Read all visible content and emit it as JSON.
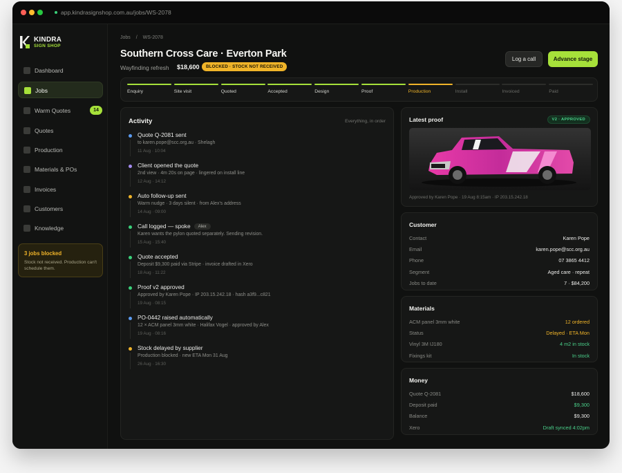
{
  "browser": {
    "url": "app.kindrasignshop.com.au/jobs/WS-2078"
  },
  "brand": {
    "name": "KINDRA",
    "sub": "SIGN SHOP",
    "accent": "#a6e13a"
  },
  "sidebar": {
    "items": [
      {
        "label": "Dashboard",
        "icon": "dashboard-icon",
        "active": false,
        "badge": ""
      },
      {
        "label": "Jobs",
        "icon": "jobs-icon",
        "active": true,
        "badge": ""
      },
      {
        "label": "Warm Quotes",
        "icon": "warm-quotes-icon",
        "active": false,
        "badge": "14"
      },
      {
        "label": "Quotes",
        "icon": "quotes-icon",
        "active": false,
        "badge": ""
      },
      {
        "label": "Production",
        "icon": "production-icon",
        "active": false,
        "badge": ""
      },
      {
        "label": "Materials & POs",
        "icon": "materials-icon",
        "active": false,
        "badge": ""
      },
      {
        "label": "Invoices",
        "icon": "invoices-icon",
        "active": false,
        "badge": ""
      },
      {
        "label": "Customers",
        "icon": "customers-icon",
        "active": false,
        "badge": ""
      },
      {
        "label": "Knowledge",
        "icon": "knowledge-icon",
        "active": false,
        "badge": ""
      }
    ],
    "alert": {
      "title": "3 jobs blocked",
      "body": "Stock not received. Production can't schedule them.",
      "color": "#f0b429"
    }
  },
  "header": {
    "breadcrumb": [
      "Jobs",
      "/",
      "WS-2078"
    ],
    "title": "Southern Cross Care · Everton Park",
    "subtitle": "Wayfinding refresh",
    "amount": "$18,600",
    "status": "BLOCKED · STOCK NOT RECEIVED",
    "status_color": "#f0b429",
    "actions": {
      "call": "Log a call",
      "advance": "Advance stage"
    }
  },
  "stages": [
    {
      "label": "Enquiry",
      "state": "done"
    },
    {
      "label": "Site visit",
      "state": "done"
    },
    {
      "label": "Quoted",
      "state": "done"
    },
    {
      "label": "Accepted",
      "state": "done"
    },
    {
      "label": "Design",
      "state": "done"
    },
    {
      "label": "Proof",
      "state": "done"
    },
    {
      "label": "Production",
      "state": "current"
    },
    {
      "label": "Install",
      "state": "todo"
    },
    {
      "label": "Invoiced",
      "state": "todo"
    },
    {
      "label": "Paid",
      "state": "todo"
    }
  ],
  "activity": {
    "title": "Activity",
    "filter": "Everything, in order",
    "events": [
      {
        "title": "Quote Q-2081 sent",
        "tag": "",
        "detail": "to karen.pope@scc.org.au · Shelagh",
        "time": "11 Aug · 10:04",
        "color": "#5b9bf0"
      },
      {
        "title": "Client opened the quote",
        "tag": "",
        "detail": "2nd view · 4m 20s on page · lingered on install line",
        "time": "12 Aug · 14:12",
        "color": "#a48cf0"
      },
      {
        "title": "Auto follow-up sent",
        "tag": "",
        "detail": "Warm nudge · 3 days silent · from Alex's address",
        "time": "14 Aug · 09:00",
        "color": "#f0b429"
      },
      {
        "title": "Call logged — spoke",
        "tag": "Alex",
        "detail": "Karen wants the pylon quoted separately. Sending revision.",
        "time": "15 Aug · 15:40",
        "color": "#3ad07a"
      },
      {
        "title": "Quote accepted",
        "tag": "",
        "detail": "Deposit $9,300 paid via Stripe · invoice drafted in Xero",
        "time": "18 Aug · 11:22",
        "color": "#3ad07a"
      },
      {
        "title": "Proof v2 approved",
        "tag": "",
        "detail": "Approved by Karen Pope · IP 203.15.242.18 · hash a3f9...c821",
        "time": "19 Aug · 08:15",
        "color": "#3ad07a"
      },
      {
        "title": "PO-0442 raised automatically",
        "tag": "",
        "detail": "12 × ACM panel 3mm white · Halifax Vogel · approved by Alex",
        "time": "19 Aug · 08:16",
        "color": "#5b9bf0"
      },
      {
        "title": "Stock delayed by supplier",
        "tag": "",
        "detail": "Production blocked · new ETA Mon 31 Aug",
        "time": "26 Aug · 16:30",
        "color": "#f0b429"
      }
    ]
  },
  "proof": {
    "title": "Latest proof",
    "badge": "V2 · APPROVED",
    "caption": "Approved by Karen Pope · 19 Aug 8:15am · IP 203.15.242.18"
  },
  "customer": {
    "title": "Customer",
    "rows": [
      {
        "label": "Contact",
        "value": "Karen Pope",
        "tone": ""
      },
      {
        "label": "Email",
        "value": "karen.pope@scc.org.au",
        "tone": ""
      },
      {
        "label": "Phone",
        "value": "07 3865 4412",
        "tone": ""
      },
      {
        "label": "Segment",
        "value": "Aged care · repeat",
        "tone": ""
      },
      {
        "label": "Jobs to date",
        "value": "7 · $84,200",
        "tone": ""
      }
    ]
  },
  "materials": {
    "title": "Materials",
    "rows": [
      {
        "label": "ACM panel 3mm white",
        "value": "12 ordered",
        "tone": "warn"
      },
      {
        "label": "Status",
        "value": "Delayed · ETA Mon",
        "tone": "warn"
      },
      {
        "label": "Vinyl 3M IJ180",
        "value": "4 m2 in stock",
        "tone": "ok"
      },
      {
        "label": "Fixings kit",
        "value": "In stock",
        "tone": "ok"
      }
    ]
  },
  "money": {
    "title": "Money",
    "rows": [
      {
        "label": "Quote Q-2081",
        "value": "$18,600",
        "tone": ""
      },
      {
        "label": "Deposit paid",
        "value": "$9,300",
        "tone": "ok"
      },
      {
        "label": "Balance",
        "value": "$9,300",
        "tone": ""
      },
      {
        "label": "Xero",
        "value": "Draft synced 4:02pm",
        "tone": "ok"
      }
    ]
  }
}
